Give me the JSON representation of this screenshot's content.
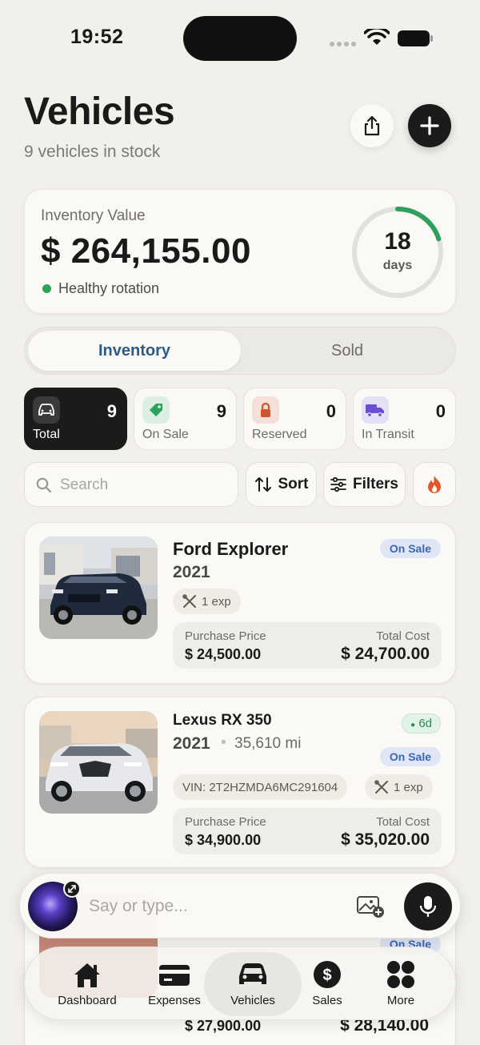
{
  "status": {
    "time": "19:52"
  },
  "header": {
    "title": "Vehicles",
    "subtitle": "9 vehicles in stock"
  },
  "value_card": {
    "label": "Inventory Value",
    "amount": "$ 264,155.00",
    "status": "Healthy rotation",
    "days_value": "18",
    "days_unit": "days",
    "ring_progress": 0.2,
    "colors": {
      "ring": "#2ea15b",
      "status_dot": "#2ea15b"
    }
  },
  "segments": {
    "active": "Inventory",
    "inactive": "Sold"
  },
  "stats": [
    {
      "label": "Total",
      "count": "9",
      "icon": "car-icon"
    },
    {
      "label": "On Sale",
      "count": "9",
      "icon": "tag-icon"
    },
    {
      "label": "Reserved",
      "count": "0",
      "icon": "lock-icon"
    },
    {
      "label": "In Transit",
      "count": "0",
      "icon": "truck-icon"
    }
  ],
  "search": {
    "placeholder": "Search"
  },
  "controls": {
    "sort": "Sort",
    "filters": "Filters"
  },
  "vehicles": [
    {
      "title": "Ford Explorer",
      "year": "2021",
      "status": "On Sale",
      "expenses": "1 exp",
      "purchase_label": "Purchase Price",
      "purchase": "$ 24,500.00",
      "total_label": "Total Cost",
      "total": "$ 24,700.00"
    },
    {
      "title": "Lexus RX 350",
      "year": "2021",
      "mileage": "35,610 mi",
      "days": "6d",
      "status": "On Sale",
      "vin": "VIN: 2T2HZMDA6MC291604",
      "expenses": "1 exp",
      "purchase_label": "Purchase Price",
      "purchase": "$ 34,900.00",
      "total_label": "Total Cost",
      "total": "$ 35,020.00"
    },
    {
      "status": "On Sale",
      "purchase": "$ 27,900.00",
      "total": "$ 28,140.00"
    }
  ],
  "assistant": {
    "placeholder": "Say or type..."
  },
  "tabs": [
    {
      "label": "Dashboard",
      "icon": "home-icon"
    },
    {
      "label": "Expenses",
      "icon": "card-icon"
    },
    {
      "label": "Vehicles",
      "icon": "car-icon"
    },
    {
      "label": "Sales",
      "icon": "dollar-icon"
    },
    {
      "label": "More",
      "icon": "grid-icon"
    }
  ]
}
